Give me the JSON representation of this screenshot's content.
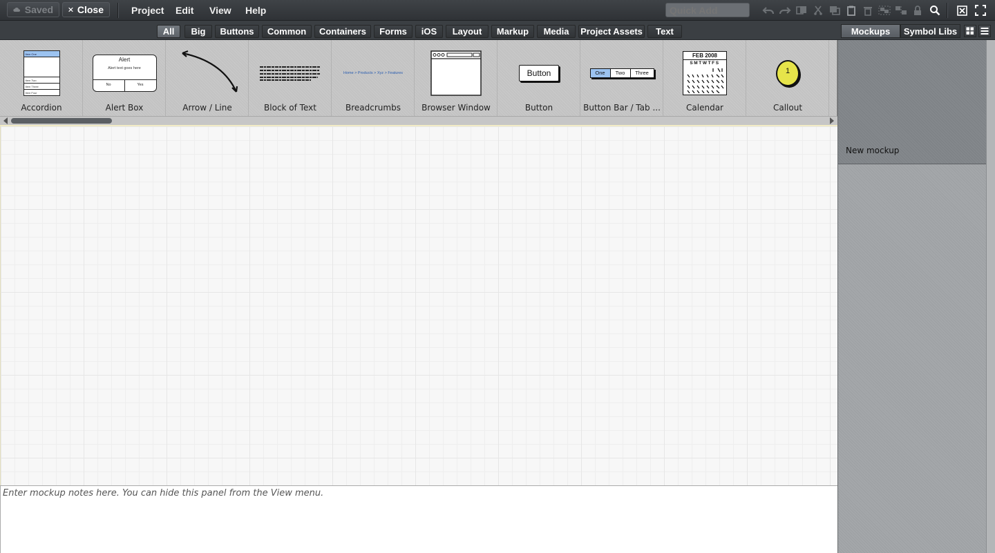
{
  "toolbar": {
    "saved_label": "Saved",
    "close_label": "Close",
    "menus": [
      "Project",
      "Edit",
      "View",
      "Help"
    ],
    "quick_add_placeholder": "Quick Add",
    "icons": [
      "undo-icon",
      "redo-icon",
      "duplicate-icon",
      "cut-icon",
      "copy-icon",
      "paste-icon",
      "delete-icon",
      "group-icon",
      "ungroup-icon",
      "lock-icon",
      "search-icon",
      "close-window-icon",
      "fullscreen-icon"
    ]
  },
  "categories": {
    "tabs": [
      "All",
      "Big",
      "Buttons",
      "Common",
      "Containers",
      "Forms",
      "iOS",
      "Layout",
      "Markup",
      "Media",
      "Project Assets",
      "Text"
    ],
    "active": "All"
  },
  "right_tabs": {
    "mockups": "Mockups",
    "symbol_libs": "Symbol Libs"
  },
  "library": {
    "items": [
      {
        "label": "Accordion",
        "icon": "accordion-thumb"
      },
      {
        "label": "Alert Box",
        "icon": "alert-box-thumb",
        "thumb_title": "Alert",
        "thumb_text": "Alert text goes here",
        "thumb_no": "No",
        "thumb_yes": "Yes"
      },
      {
        "label": "Arrow / Line",
        "icon": "arrow-line-thumb"
      },
      {
        "label": "Block of Text",
        "icon": "block-of-text-thumb"
      },
      {
        "label": "Breadcrumbs",
        "icon": "breadcrumbs-thumb",
        "thumb_text": "Home > Products > Xyz > Features"
      },
      {
        "label": "Browser Window",
        "icon": "browser-window-thumb"
      },
      {
        "label": "Button",
        "icon": "button-thumb",
        "thumb_text": "Button"
      },
      {
        "label": "Button Bar / Tab ...",
        "icon": "button-bar-thumb",
        "thumb_one": "One",
        "thumb_two": "Two",
        "thumb_three": "Three"
      },
      {
        "label": "Calendar",
        "icon": "calendar-thumb",
        "thumb_text": "FEB 2008"
      },
      {
        "label": "Callout",
        "icon": "callout-thumb",
        "thumb_text": "1"
      }
    ],
    "accordion_rows": [
      "Item One",
      "Item Two",
      "Item Three",
      "Item Four"
    ],
    "calendar_days": "SMTWTFS"
  },
  "notes": {
    "placeholder": "Enter mockup notes here. You can hide this panel from the View menu."
  },
  "mockups": {
    "items": [
      "New mockup"
    ]
  },
  "colors": {
    "accent_blue": "#9cc3f0",
    "callout_yellow": "#e6e44a"
  }
}
